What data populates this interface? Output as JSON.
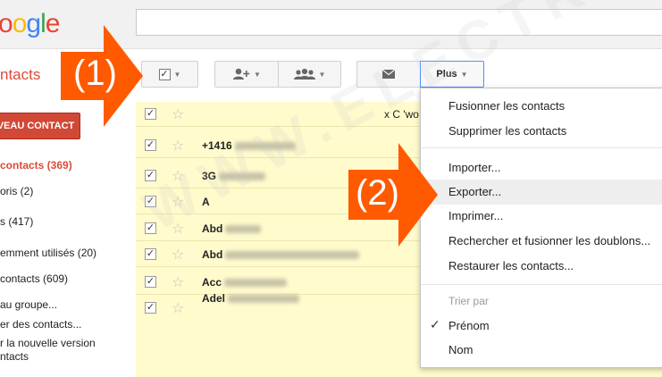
{
  "header": {
    "logo_fragment": "oogle"
  },
  "sidebar": {
    "title": "ntacts",
    "new_contact_label": "VEAU CONTACT",
    "items": [
      {
        "label": "contacts (369)",
        "active": true
      },
      {
        "label": "oris (2)",
        "active": false
      },
      {
        "label": "s (417)",
        "active": false
      },
      {
        "label": "emment utilisés (20)",
        "active": false
      },
      {
        "label": " contacts (609)",
        "active": false
      },
      {
        "label": "au groupe...",
        "active": false
      },
      {
        "label": "er des contacts...",
        "active": false
      },
      {
        "label": "r la nouvelle version",
        "active": false
      },
      {
        "label": "ntacts",
        "active": false
      }
    ]
  },
  "toolbar": {
    "select_icon": "checkbox-icon",
    "add_to_contacts_icon": "add-person-icon",
    "groups_icon": "group-icon",
    "email_icon": "envelope-icon",
    "more_label": "Plus"
  },
  "contacts": {
    "rows": [
      {
        "name": "",
        "extra": "x C 'wo"
      },
      {
        "name": "+1416",
        "extra": ""
      },
      {
        "name": "3G",
        "extra": ""
      },
      {
        "name": "A",
        "extra": ""
      },
      {
        "name": "Abd",
        "extra": ""
      },
      {
        "name": "Abd",
        "extra": ""
      },
      {
        "name": "Acc",
        "extra": ""
      },
      {
        "name": "Adel",
        "extra": ""
      }
    ]
  },
  "menu": {
    "items_group1": [
      "Fusionner les contacts",
      "Supprimer les contacts"
    ],
    "items_group2": [
      "Importer...",
      "Exporter...",
      "Imprimer...",
      "Rechercher et fusionner les doublons...",
      "Restaurer les contacts..."
    ],
    "sort_header": "Trier par",
    "sort_options": [
      {
        "label": "Prénom",
        "checked": true
      },
      {
        "label": "Nom",
        "checked": false
      }
    ],
    "highlighted": "Exporter..."
  },
  "annotations": {
    "step1": "(1)",
    "step2": "(2)"
  },
  "watermark": "WWW.ELECTRODZ.COM",
  "colors": {
    "accent_red": "#d14836",
    "arrow_orange": "#ff5a00",
    "list_highlight": "#fffbcc",
    "focus_blue": "#4d90fe"
  }
}
